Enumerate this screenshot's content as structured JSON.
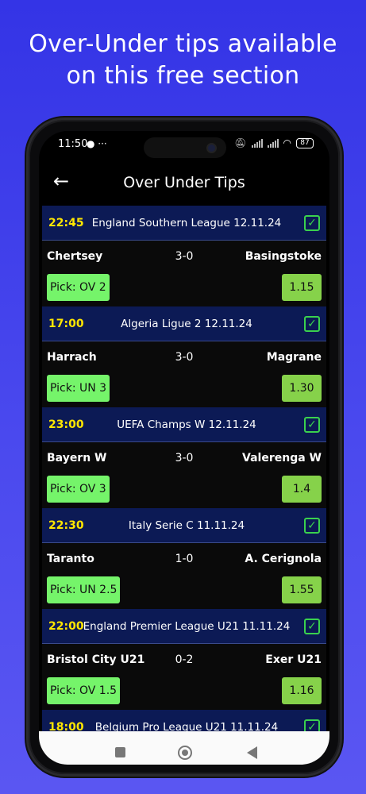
{
  "headline": {
    "line1": "Over-Under tips available",
    "line2": "on this free section"
  },
  "status_bar": {
    "time": "11:50",
    "notification_icons": "● ···",
    "battery": "87"
  },
  "app_bar": {
    "back_icon": "←",
    "title": "Over Under Tips"
  },
  "tips": [
    {
      "time": "22:45",
      "league": "England Southern League 12.11.24",
      "home": "Chertsey",
      "score": "3-0",
      "away": "Basingstoke",
      "pick": "Pick: OV 2",
      "odds": "1.15"
    },
    {
      "time": "17:00",
      "league": "Algeria Ligue 2 12.11.24",
      "home": "Harrach",
      "score": "3-0",
      "away": "Magrane",
      "pick": "Pick: UN 3",
      "odds": "1.30"
    },
    {
      "time": "23:00",
      "league": "UEFA Champs W 12.11.24",
      "home": "Bayern W",
      "score": "3-0",
      "away": "Valerenga W",
      "pick": "Pick: OV 3",
      "odds": "1.4"
    },
    {
      "time": "22:30",
      "league": "Italy Serie C 11.11.24",
      "home": "Taranto",
      "score": "1-0",
      "away": "A. Cerignola",
      "pick": "Pick: UN 2.5",
      "odds": "1.55"
    },
    {
      "time": "22:00",
      "league": "England Premier League U21 11.11.24",
      "home": "Bristol City U21",
      "score": "0-2",
      "away": "Exer U21",
      "pick": "Pick: OV 1.5",
      "odds": "1.16"
    },
    {
      "time": "18:00",
      "league": "Belgium Pro League U21 11.11.24",
      "home": "",
      "score": "",
      "away": "",
      "pick": "",
      "odds": ""
    }
  ],
  "check_icon": "✓",
  "colors": {
    "background": "#3434e6",
    "card_header": "#0c1a55",
    "time_yellow": "#ffe600",
    "pick_green": "#75f46a",
    "odds_green": "#86d24a",
    "check_green": "#3ad14e"
  }
}
